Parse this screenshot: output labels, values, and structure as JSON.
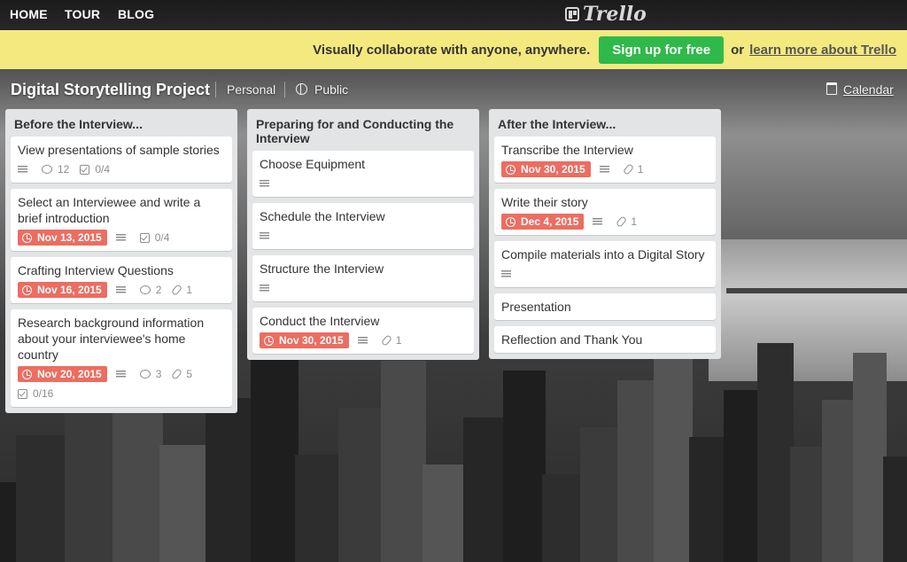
{
  "topnav": {
    "home": "HOME",
    "tour": "TOUR",
    "blog": "BLOG",
    "logo_text": "Trello"
  },
  "banner": {
    "promo": "Visually collaborate with anyone, anywhere.",
    "signup": "Sign up for free",
    "or": "or",
    "learn_more": "learn more about Trello",
    "bg_color": "#f4e97e",
    "signup_color": "#2fb94a"
  },
  "board": {
    "title": "Digital Storytelling Project",
    "team": "Personal",
    "visibility": "Public",
    "calendar": "Calendar"
  },
  "lists": [
    {
      "title": "Before the Interview...",
      "cards": [
        {
          "title": "View presentations of sample stories",
          "due": "",
          "description": true,
          "comments": "12",
          "attachments": "",
          "checklist": "0/4"
        },
        {
          "title": "Select an Interviewee and write a brief introduction",
          "due": "Nov 13, 2015",
          "description": true,
          "comments": "",
          "attachments": "",
          "checklist": "0/4"
        },
        {
          "title": "Crafting Interview Questions",
          "due": "Nov 16, 2015",
          "description": true,
          "comments": "2",
          "attachments": "1",
          "checklist": ""
        },
        {
          "title": "Research background information about your interviewee's home country",
          "due": "Nov 20, 2015",
          "description": true,
          "comments": "3",
          "attachments": "5",
          "checklist": "0/16"
        }
      ]
    },
    {
      "title": "Preparing for and Conducting the Interview",
      "cards": [
        {
          "title": "Choose Equipment",
          "due": "",
          "description": true,
          "comments": "",
          "attachments": "",
          "checklist": ""
        },
        {
          "title": "Schedule the Interview",
          "due": "",
          "description": true,
          "comments": "",
          "attachments": "",
          "checklist": ""
        },
        {
          "title": "Structure the Interview",
          "due": "",
          "description": true,
          "comments": "",
          "attachments": "",
          "checklist": ""
        },
        {
          "title": "Conduct the Interview",
          "due": "Nov 30, 2015",
          "description": true,
          "comments": "",
          "attachments": "1",
          "checklist": ""
        }
      ]
    },
    {
      "title": "After the Interview...",
      "cards": [
        {
          "title": "Transcribe the Interview",
          "due": "Nov 30, 2015",
          "description": true,
          "comments": "",
          "attachments": "1",
          "checklist": ""
        },
        {
          "title": "Write their story",
          "due": "Dec 4, 2015",
          "description": true,
          "comments": "",
          "attachments": "1",
          "checklist": ""
        },
        {
          "title": "Compile materials into a Digital Story",
          "due": "",
          "description": true,
          "comments": "",
          "attachments": "",
          "checklist": ""
        },
        {
          "title": "Presentation",
          "due": "",
          "description": false,
          "comments": "",
          "attachments": "",
          "checklist": ""
        },
        {
          "title": "Reflection and Thank You",
          "due": "",
          "description": false,
          "comments": "",
          "attachments": "",
          "checklist": ""
        }
      ]
    }
  ],
  "colors": {
    "due_badge": "#ec6d61",
    "list_bg": "#e2e4e6"
  },
  "icons": {
    "due": "clock-icon",
    "description": "description-icon",
    "comments": "comment-icon",
    "attachments": "paperclip-icon",
    "checklist": "checklist-icon",
    "visibility": "globe-icon",
    "calendar": "calendar-icon"
  }
}
